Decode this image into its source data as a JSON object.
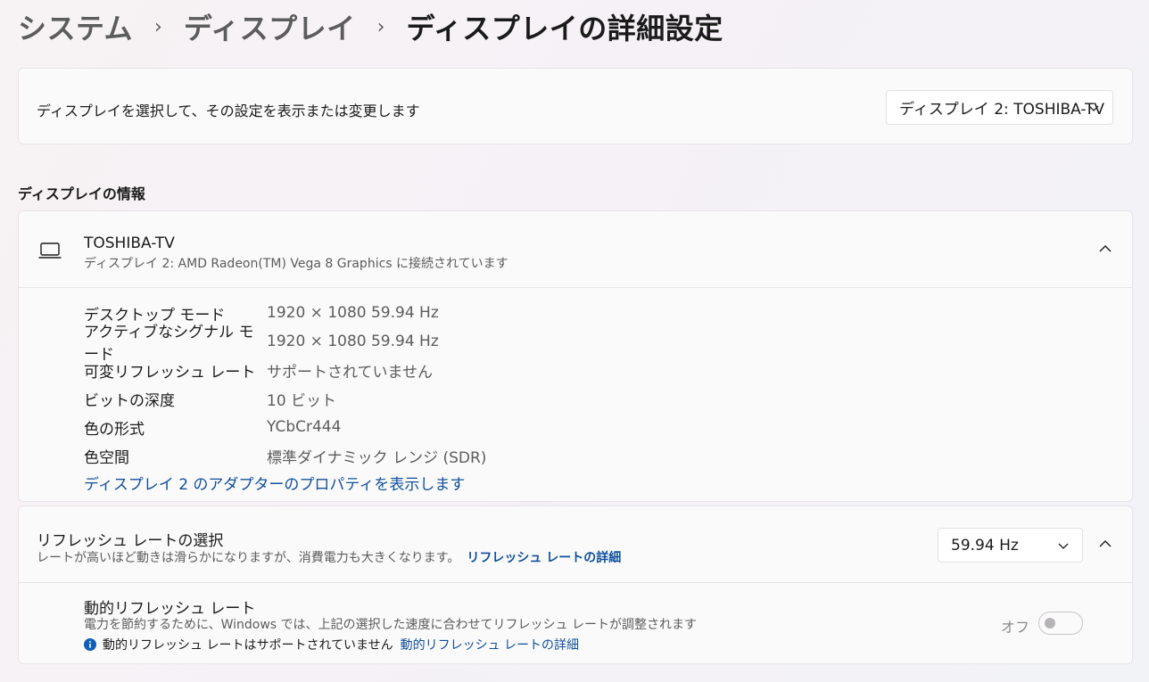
{
  "breadcrumb": {
    "level1": "システム",
    "level2": "ディスプレイ",
    "current": "ディスプレイの詳細設定",
    "separator": "›"
  },
  "select_display": {
    "label": "ディスプレイを選択して、その設定を表示または変更します",
    "selected": "ディスプレイ 2: TOSHIBA-TV"
  },
  "display_info": {
    "section_title": "ディスプレイの情報",
    "name": "TOSHIBA-TV",
    "subtitle": "ディスプレイ 2: AMD Radeon(TM) Vega 8 Graphics に接続されています",
    "properties": [
      {
        "key": "デスクトップ モード",
        "value": "1920 × 1080 59.94 Hz"
      },
      {
        "key": "アクティブなシグナル モード",
        "value": "1920 × 1080 59.94 Hz"
      },
      {
        "key": "可変リフレッシュ レート",
        "value": "サポートされていません"
      },
      {
        "key": "ビットの深度",
        "value": "10 ビット"
      },
      {
        "key": "色の形式",
        "value": "YCbCr444"
      },
      {
        "key": "色空間",
        "value": "標準ダイナミック レンジ (SDR)"
      }
    ],
    "adapter_link": "ディスプレイ 2 のアダプターのプロパティを表示します"
  },
  "refresh_rate": {
    "title": "リフレッシュ レートの選択",
    "description": "レートが高いほど動きは滑らかになりますが、消費電力も大きくなります。",
    "details_link": "リフレッシュ レートの詳細",
    "selected": "59.94 Hz",
    "dynamic": {
      "title": "動的リフレッシュ レート",
      "description": "電力を節約するために、Windows では、上記の選択した速度に合わせてリフレッシュ レートが調整されます",
      "note": "動的リフレッシュ レートはサポートされていません",
      "note_link": "動的リフレッシュ レートの詳細",
      "toggle_label": "オフ"
    }
  },
  "icons": {
    "laptop": "laptop-icon",
    "chevron_down": "chevron-down-icon",
    "chevron_up": "chevron-up-icon",
    "info": "info-icon"
  },
  "colors": {
    "link": "#0f4f9a",
    "info_icon": "#0f5fb8"
  }
}
